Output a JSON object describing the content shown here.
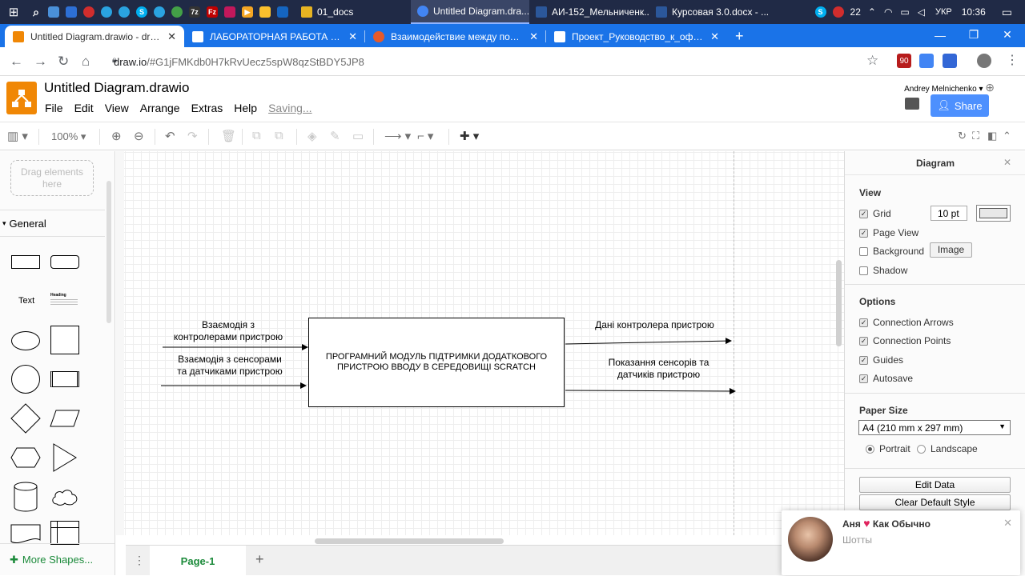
{
  "taskbar": {
    "tasks": [
      {
        "label": "01_docs",
        "color": "#e6b422"
      },
      {
        "label": "Untitled Diagram.dra...",
        "color": "#4285f4",
        "active": true
      },
      {
        "label": "АИ-152_Мельниченк...",
        "color": "#2b579a"
      },
      {
        "label": "Курсовая 3.0.docx - ...",
        "color": "#2b579a"
      }
    ],
    "lang": "УКР",
    "time": "10:36",
    "temp": "22"
  },
  "browser": {
    "tabs": [
      {
        "label": "Untitled Diagram.drawio - draw.io",
        "fav": "#f08705",
        "active": true
      },
      {
        "label": "ЛАБОРАТОРНАЯ РАБОТА 1 - on",
        "fav": "#ffffff"
      },
      {
        "label": "Взаимодействие между пользо",
        "fav": "#e55a2b"
      },
      {
        "label": "Проект_Руководство_к_оформ",
        "fav": "#ffffff"
      }
    ],
    "new_tab": "+",
    "url_host": "draw.io",
    "url_path": "/#G1jFMKdb0H7kRvUecz5spW8qzStBDY5JP8",
    "ext_badge": "90"
  },
  "app": {
    "title": "Untitled Diagram.drawio",
    "menu": [
      "File",
      "Edit",
      "View",
      "Arrange",
      "Extras",
      "Help"
    ],
    "saving": "Saving...",
    "user": "Andrey Melnichenko",
    "share": "Share",
    "zoom": "100%"
  },
  "sidebar": {
    "drag_hint": "Drag elements here",
    "section": "General",
    "text_shape": "Text",
    "heading_shape": "Heading",
    "more_shapes": "More Shapes..."
  },
  "diagram": {
    "in1": "Взаємодія з\nконтролерами пристрою",
    "in2": "Взаємодія з сенсорами\nта датчиками пристрою",
    "box": "ПРОГРАМНИЙ МОДУЛЬ ПІДТРИМКИ ДОДАТКОВОГО ПРИСТРОЮ ВВОДУ В СЕРЕДОВИЩІ SCRATCH",
    "out1": "Дані контролера пристрою",
    "out2": "Показання сенсорів та\nдатчиків пристрою"
  },
  "pages": {
    "current": "Page-1",
    "add": "+"
  },
  "panel": {
    "title": "Diagram",
    "view_title": "View",
    "grid": "Grid",
    "grid_size": "10 pt",
    "page_view": "Page View",
    "background": "Background",
    "image_btn": "Image",
    "shadow": "Shadow",
    "options_title": "Options",
    "connection_arrows": "Connection Arrows",
    "connection_points": "Connection Points",
    "guides": "Guides",
    "autosave": "Autosave",
    "paper_title": "Paper Size",
    "paper_value": "A4 (210 mm x 297 mm)",
    "portrait": "Portrait",
    "landscape": "Landscape",
    "edit_data": "Edit Data",
    "clear_style": "Clear Default Style"
  },
  "notification": {
    "name": "Аня",
    "status": "Как Обычно",
    "subtitle": "Шотты"
  }
}
